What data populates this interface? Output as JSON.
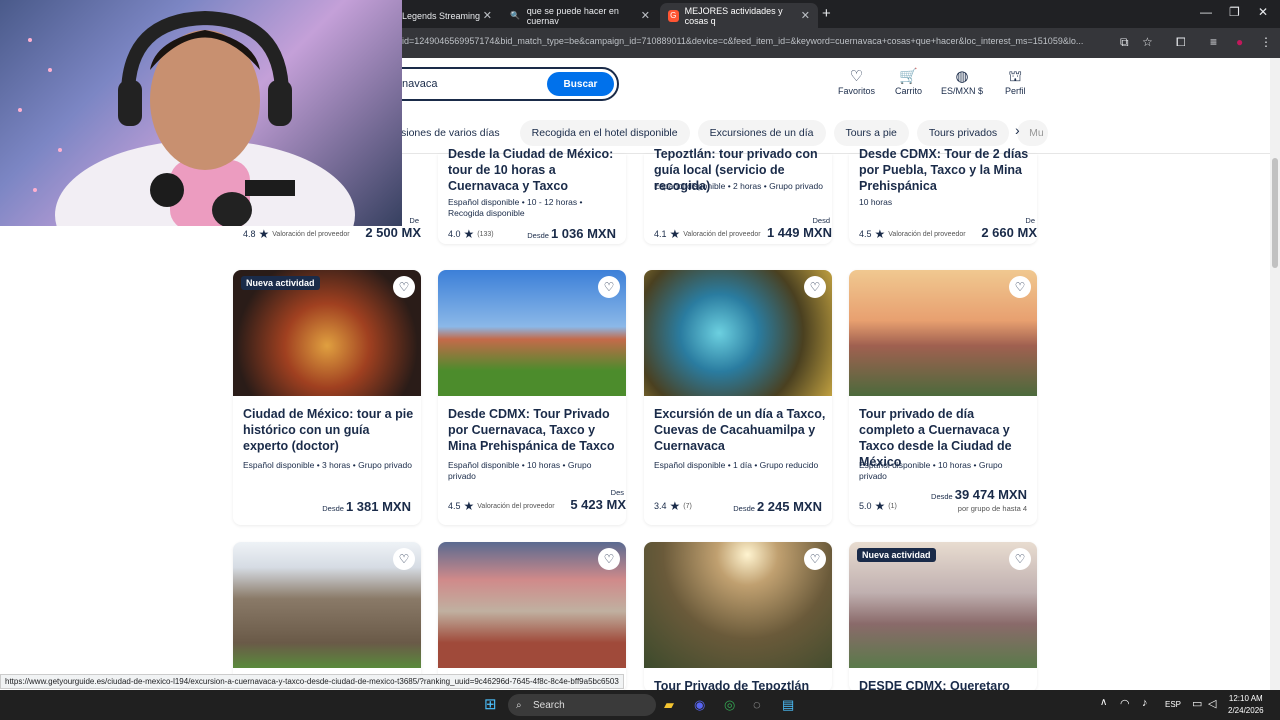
{
  "browser": {
    "tabs": [
      {
        "title": "Legends Streaming",
        "active": false
      },
      {
        "title": "que se puede hacer en cuernav",
        "active": false
      },
      {
        "title": "MEJORES actividades y cosas q",
        "active": true
      }
    ],
    "url": "id=1249046569957174&bid_match_type=be&campaign_id=710889011&device=c&feed_item_id=&keyword=cuernavaca+cosas+que+hacer&loc_interest_ms=151059&lo..."
  },
  "header": {
    "search_value": "navaca",
    "search_button": "Buscar",
    "nav": [
      {
        "label": "Favoritos",
        "icon": "heart-icon"
      },
      {
        "label": "Carrito",
        "icon": "cart-icon"
      },
      {
        "label": "ES/MXN $",
        "icon": "globe-icon"
      },
      {
        "label": "Perfil",
        "icon": "profile-icon"
      }
    ],
    "chips": [
      "siones de varios días",
      "Recogida en el hotel disponible",
      "Excursiones de un día",
      "Tours a pie",
      "Tours privados",
      "Mu"
    ]
  },
  "top_row": [
    {
      "title": "",
      "meta": "",
      "rating": "4.8",
      "reviews": "Valoración del proveedor",
      "price_prefix": "De",
      "price": "2 500 MX"
    },
    {
      "title": "Desde la Ciudad de México: tour de 10 horas a Cuernavaca y Taxco",
      "meta": "Español disponible • 10 - 12 horas • Recogida disponible",
      "rating": "4.0",
      "reviews": "(133)",
      "price_prefix": "Desde",
      "price": "1 036 MXN"
    },
    {
      "title": "Tepoztlán: tour privado con guía local (servicio de recogida)",
      "meta": "Español disponible • 2 horas • Grupo privado",
      "rating": "4.1",
      "reviews": "Valoración del proveedor",
      "price_prefix": "Desd",
      "price": "1 449 MXN"
    },
    {
      "title": "Desde CDMX: Tour de 2 días por Puebla, Taxco y la Mina Prehispánica",
      "meta": "10 horas",
      "rating": "4.5",
      "reviews": "Valoración del proveedor",
      "price_prefix": "De",
      "price": "2 660 MX"
    }
  ],
  "cards": [
    {
      "badge": "Nueva actividad",
      "title": "Ciudad de México: tour a pie histórico con un guía experto (doctor)",
      "meta": "Español disponible • 3 horas • Grupo privado",
      "rating": "",
      "reviews": "",
      "price_prefix": "Desde",
      "price": "1 381 MXN",
      "unit": ""
    },
    {
      "badge": "",
      "title": "Desde CDMX: Tour Privado por Cuernavaca, Taxco y Mina Prehispánica de Taxco",
      "meta": "Español disponible • 10 horas • Grupo privado",
      "rating": "4.5",
      "reviews": "Valoración del proveedor",
      "price_prefix": "Des",
      "price": "5 423 MX",
      "unit": ""
    },
    {
      "badge": "",
      "title": "Excursión de un día a Taxco, Cuevas de Cacahuamilpa y Cuernavaca",
      "meta": "Español disponible • 1 día • Grupo reducido",
      "rating": "3.4",
      "reviews": "(7)",
      "price_prefix": "Desde",
      "price": "2 245 MXN",
      "unit": ""
    },
    {
      "badge": "",
      "title": "Tour privado de día completo a Cuernavaca y Taxco desde la Ciudad de México",
      "meta": "Español disponible • 10 horas • Grupo privado",
      "rating": "5.0",
      "reviews": "(1)",
      "price_prefix": "Desde",
      "price": "39 474 MXN",
      "unit": "por grupo de hasta 4"
    }
  ],
  "bottom_row": [
    {
      "badge": "",
      "title": ""
    },
    {
      "badge": "",
      "title": ""
    },
    {
      "badge": "",
      "title": "Tour Privado de Tepoztlán en"
    },
    {
      "badge": "Nueva actividad",
      "title": "DESDE CDMX: Queretaro"
    }
  ],
  "status_url": "https://www.getyourguide.es/ciudad-de-mexico-l194/excursion-a-cuernavaca-y-taxco-desde-ciudad-de-mexico-t3685/?ranking_uuid=9c46296d-7645-4f8c-8c4e-bff9a5bc6503",
  "taskbar": {
    "search": "Search",
    "lang": "ESP",
    "time": "12:10 AM",
    "date": "2/24/2026"
  },
  "colors": {
    "brand": "#0071eb",
    "navy": "#1a2b49"
  }
}
